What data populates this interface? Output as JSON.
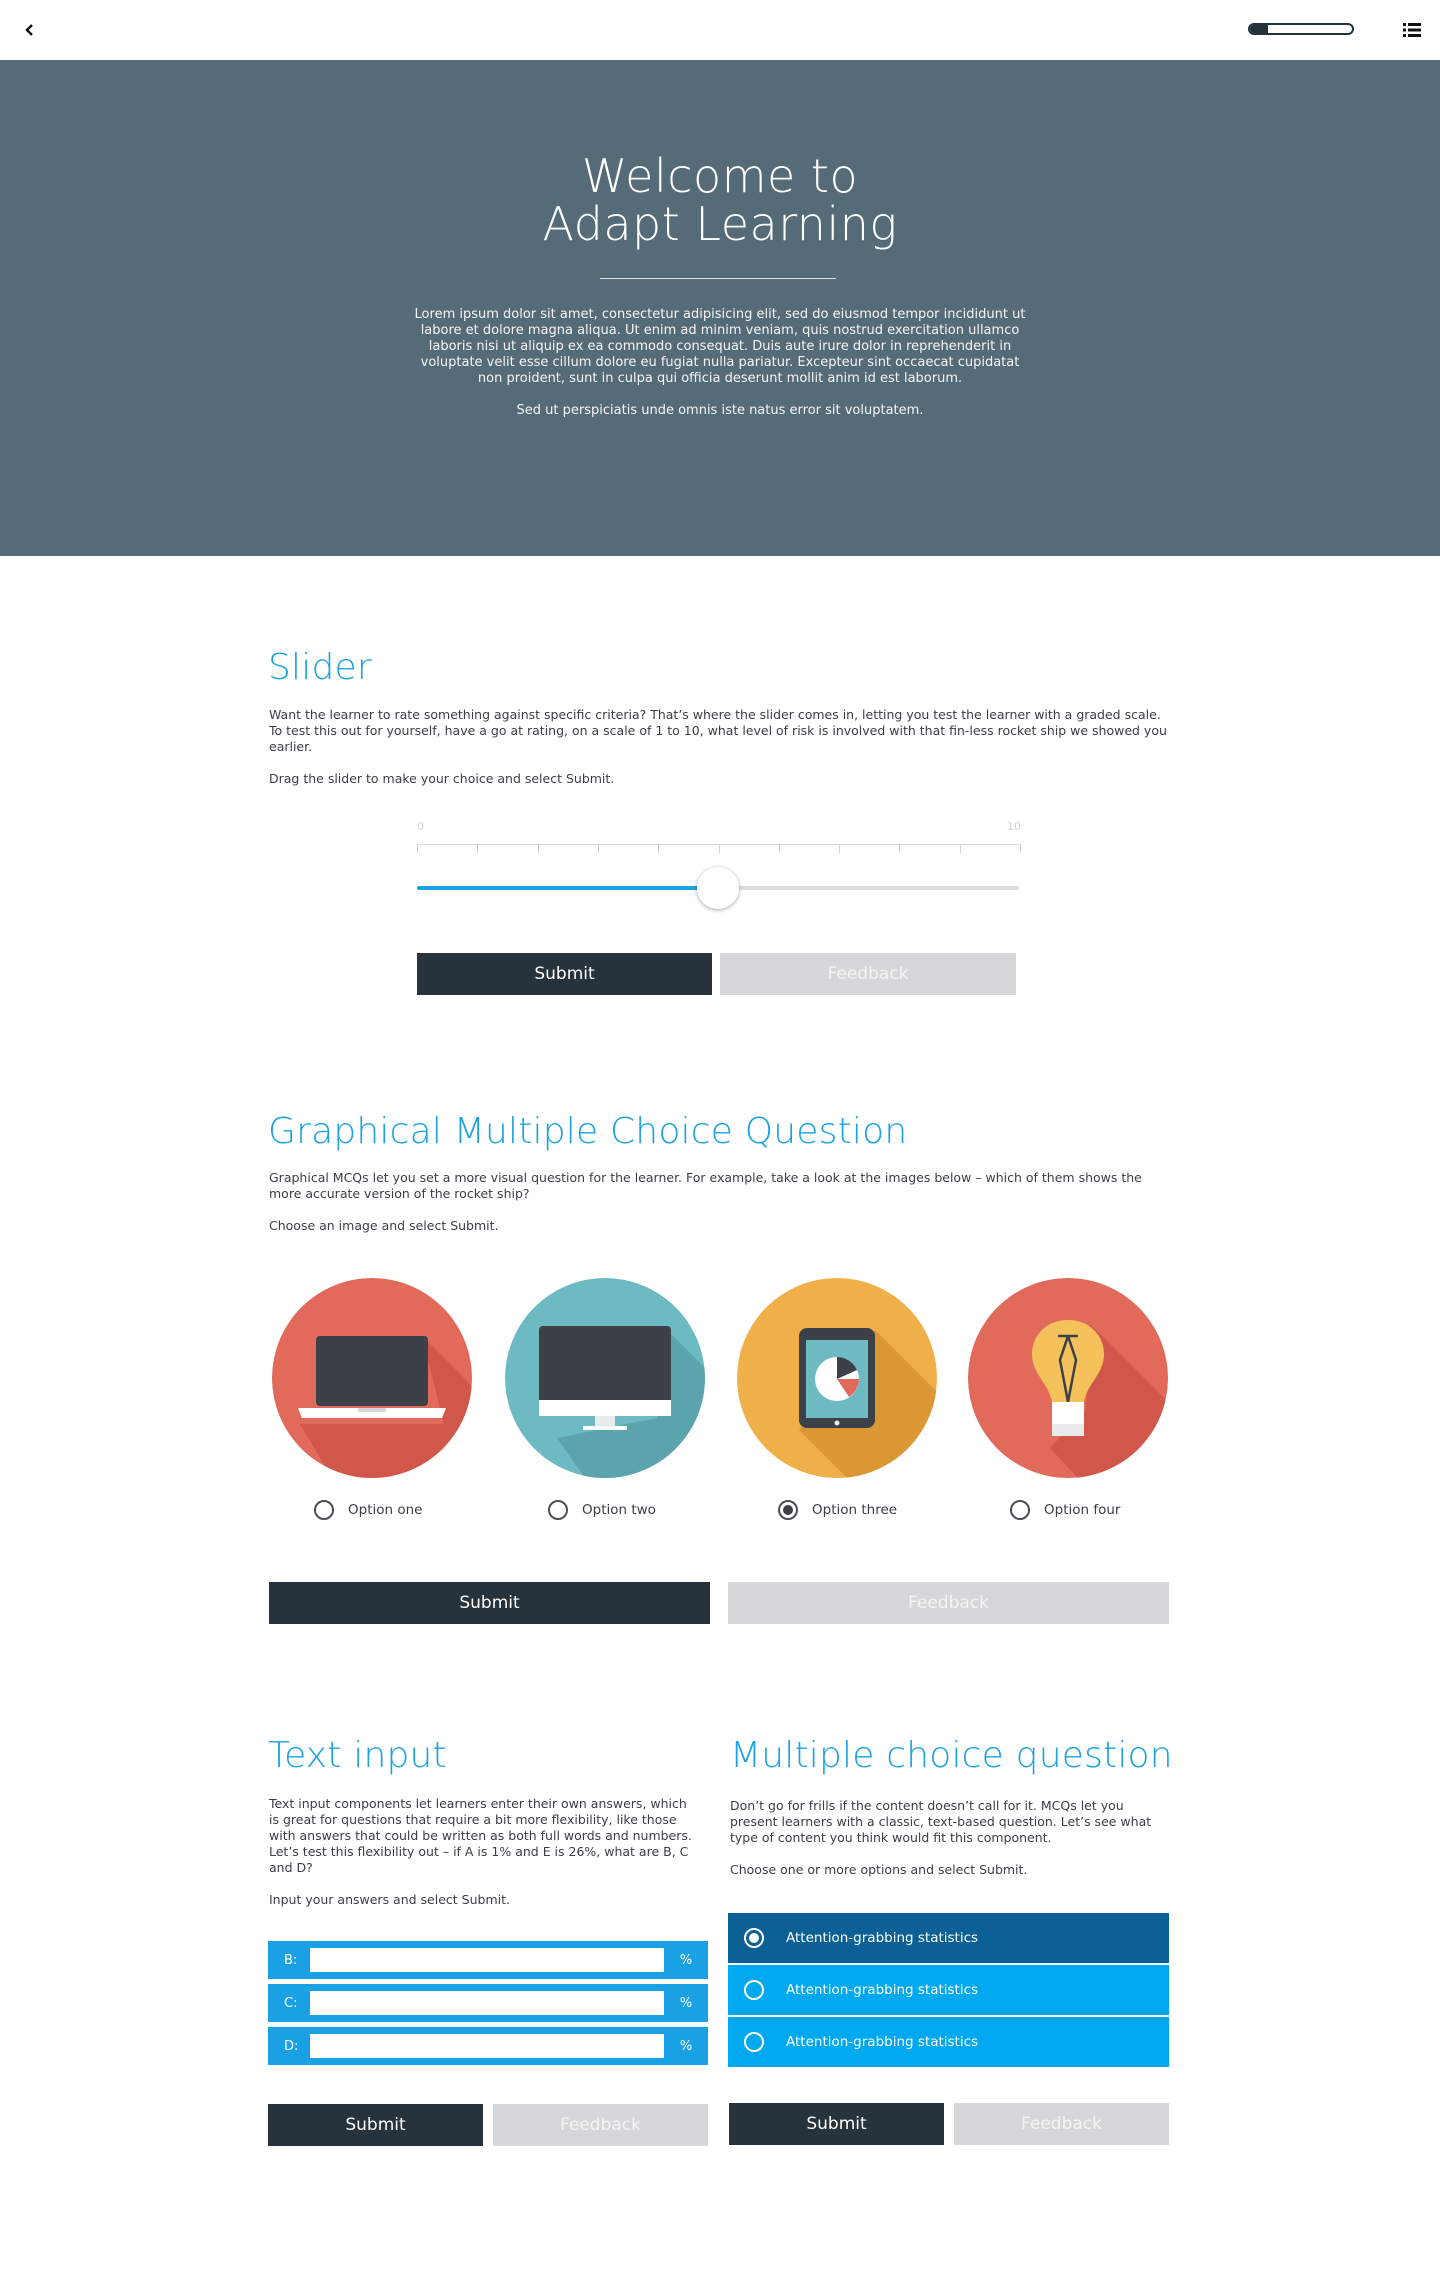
{
  "nav": {
    "back_icon": "chevron-left-icon",
    "menu_icon": "list-icon",
    "progress_fraction": 0.18
  },
  "hero": {
    "title_line1": "Welcome to",
    "title_line2": "Adapt Learning",
    "body": "Lorem ipsum dolor sit amet, consectetur adipisicing elit, sed do eiusmod tempor incididunt ut labore et dolore magna aliqua. Ut enim ad minim veniam, quis nostrud exercitation ullamco laboris nisi ut aliquip ex ea commodo consequat. Duis aute irure dolor in reprehenderit in voluptate velit esse cillum dolore eu fugiat nulla pariatur. Excepteur sint occaecat cupidatat non proident, sunt in culpa qui officia deserunt mollit anim id est laborum.",
    "subtext": "Sed ut perspiciatis unde omnis iste natus error sit voluptatem.",
    "background_color": "#566b78"
  },
  "slider": {
    "title": "Slider",
    "body": "Want the learner to rate something against specific criteria? That’s where the slider comes in, letting you test the learner with a graded scale. To test this out for yourself, have a go at rating, on a scale of 1 to 10, what level of risk is involved with that fin-less rocket ship we showed you earlier.",
    "instruction": "Drag the slider to make your choice and select Submit.",
    "scale_min_label": "0",
    "scale_max_label": "10",
    "scale_min": 0,
    "scale_max": 10,
    "value": 5,
    "submit_label": "Submit",
    "feedback_label": "Feedback"
  },
  "gmcq": {
    "title": "Graphical Multiple Choice Question",
    "body": "Graphical MCQs let you set a more visual question for the learner. For example, take a look at the images below – which of them shows the more accurate version of the rocket ship?",
    "instruction": "Choose an image and select Submit.",
    "options": [
      {
        "label": "Option one",
        "icon": "laptop-icon",
        "color": "#e16a5b",
        "selected": false
      },
      {
        "label": "Option two",
        "icon": "monitor-icon",
        "color": "#6ebac3",
        "selected": false
      },
      {
        "label": "Option three",
        "icon": "tablet-chart-icon",
        "color": "#efb04a",
        "selected": true
      },
      {
        "label": "Option four",
        "icon": "lightbulb-icon",
        "color": "#e16a5b",
        "selected": false
      }
    ],
    "submit_label": "Submit",
    "feedback_label": "Feedback"
  },
  "text_input": {
    "title": "Text input",
    "body": "Text input components let learners enter their own answers, which is great for questions that require a bit more flexibility, like those with answers that could be written as both full words and numbers. Let’s test this flexibility out – if A is 1% and E is 26%, what are B, C and D?",
    "instruction": "Input your answers and select Submit.",
    "rows": [
      {
        "prefix": "B:",
        "value": "",
        "suffix": "%"
      },
      {
        "prefix": "C:",
        "value": "",
        "suffix": "%"
      },
      {
        "prefix": "D:",
        "value": "",
        "suffix": "%"
      }
    ],
    "submit_label": "Submit",
    "feedback_label": "Feedback"
  },
  "mcq": {
    "title": "Multiple choice question",
    "body": "Don’t go for frills if the content doesn’t call for it. MCQs let you present learners with a classic, text-based question. Let’s see what type of content you think would fit this component.",
    "instruction": "Choose one or more options and select Submit.",
    "options": [
      {
        "label": "Attention-grabbing statistics",
        "selected": true
      },
      {
        "label": "Attention-grabbing statistics",
        "selected": false
      },
      {
        "label": "Attention-grabbing statistics",
        "selected": false
      }
    ],
    "selected_color": "#0b6196",
    "unselected_color": "#00a8f0",
    "submit_label": "Submit",
    "feedback_label": "Feedback"
  },
  "colors": {
    "accent": "#1aa1e3",
    "button_dark": "#28323a",
    "button_disabled": "#d6d7d9"
  }
}
